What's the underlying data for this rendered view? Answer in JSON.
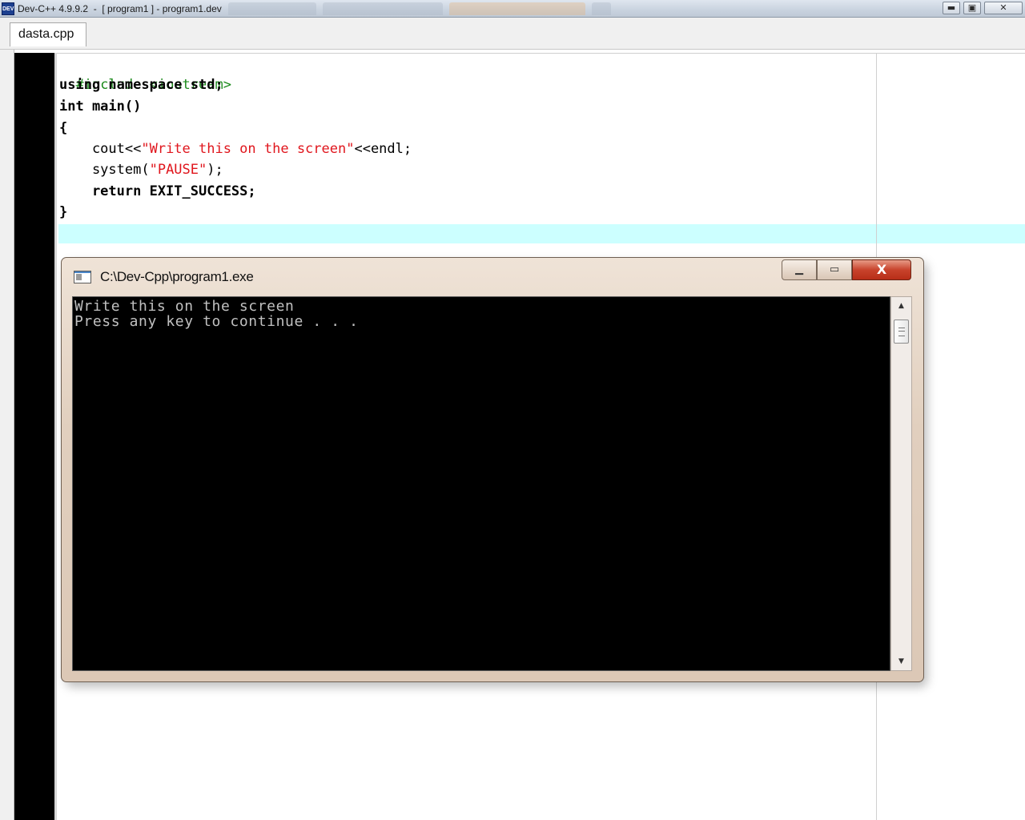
{
  "ide": {
    "icon_text": "DEV",
    "title": "Dev-C++ 4.9.9.2  -  [ program1 ] - program1.dev",
    "window_controls": {
      "minimize": "▬",
      "maximize": "▣",
      "close": "✕"
    }
  },
  "tabs": [
    {
      "label": "dasta.cpp"
    }
  ],
  "code": {
    "line1_directive": "#include <iostream>",
    "line2": "using namespace std;",
    "line3": "int main()",
    "line4": "{",
    "line5_cout": "    cout<<",
    "line5_string": "\"Write this on the screen\"",
    "line5_end": "<<endl;",
    "line6_system": "    system(",
    "line6_string": "\"PAUSE\"",
    "line6_end": ");",
    "line7": "    return EXIT_SUCCESS;",
    "line8": "}"
  },
  "console": {
    "title": "C:\\Dev-Cpp\\program1.exe",
    "output_line1": "Write this on the screen",
    "output_line2": "Press any key to continue . . .",
    "controls": {
      "minimize": "▁",
      "maximize": "▭",
      "close": "X"
    },
    "scroll_up": "▲",
    "scroll_down": "▼"
  },
  "colors": {
    "current_line_highlight": "#ccffff",
    "string_literal": "#e0161d",
    "preprocessor": "#1b8a1b",
    "console_background": "#000000",
    "console_text": "#c0c0c0"
  }
}
